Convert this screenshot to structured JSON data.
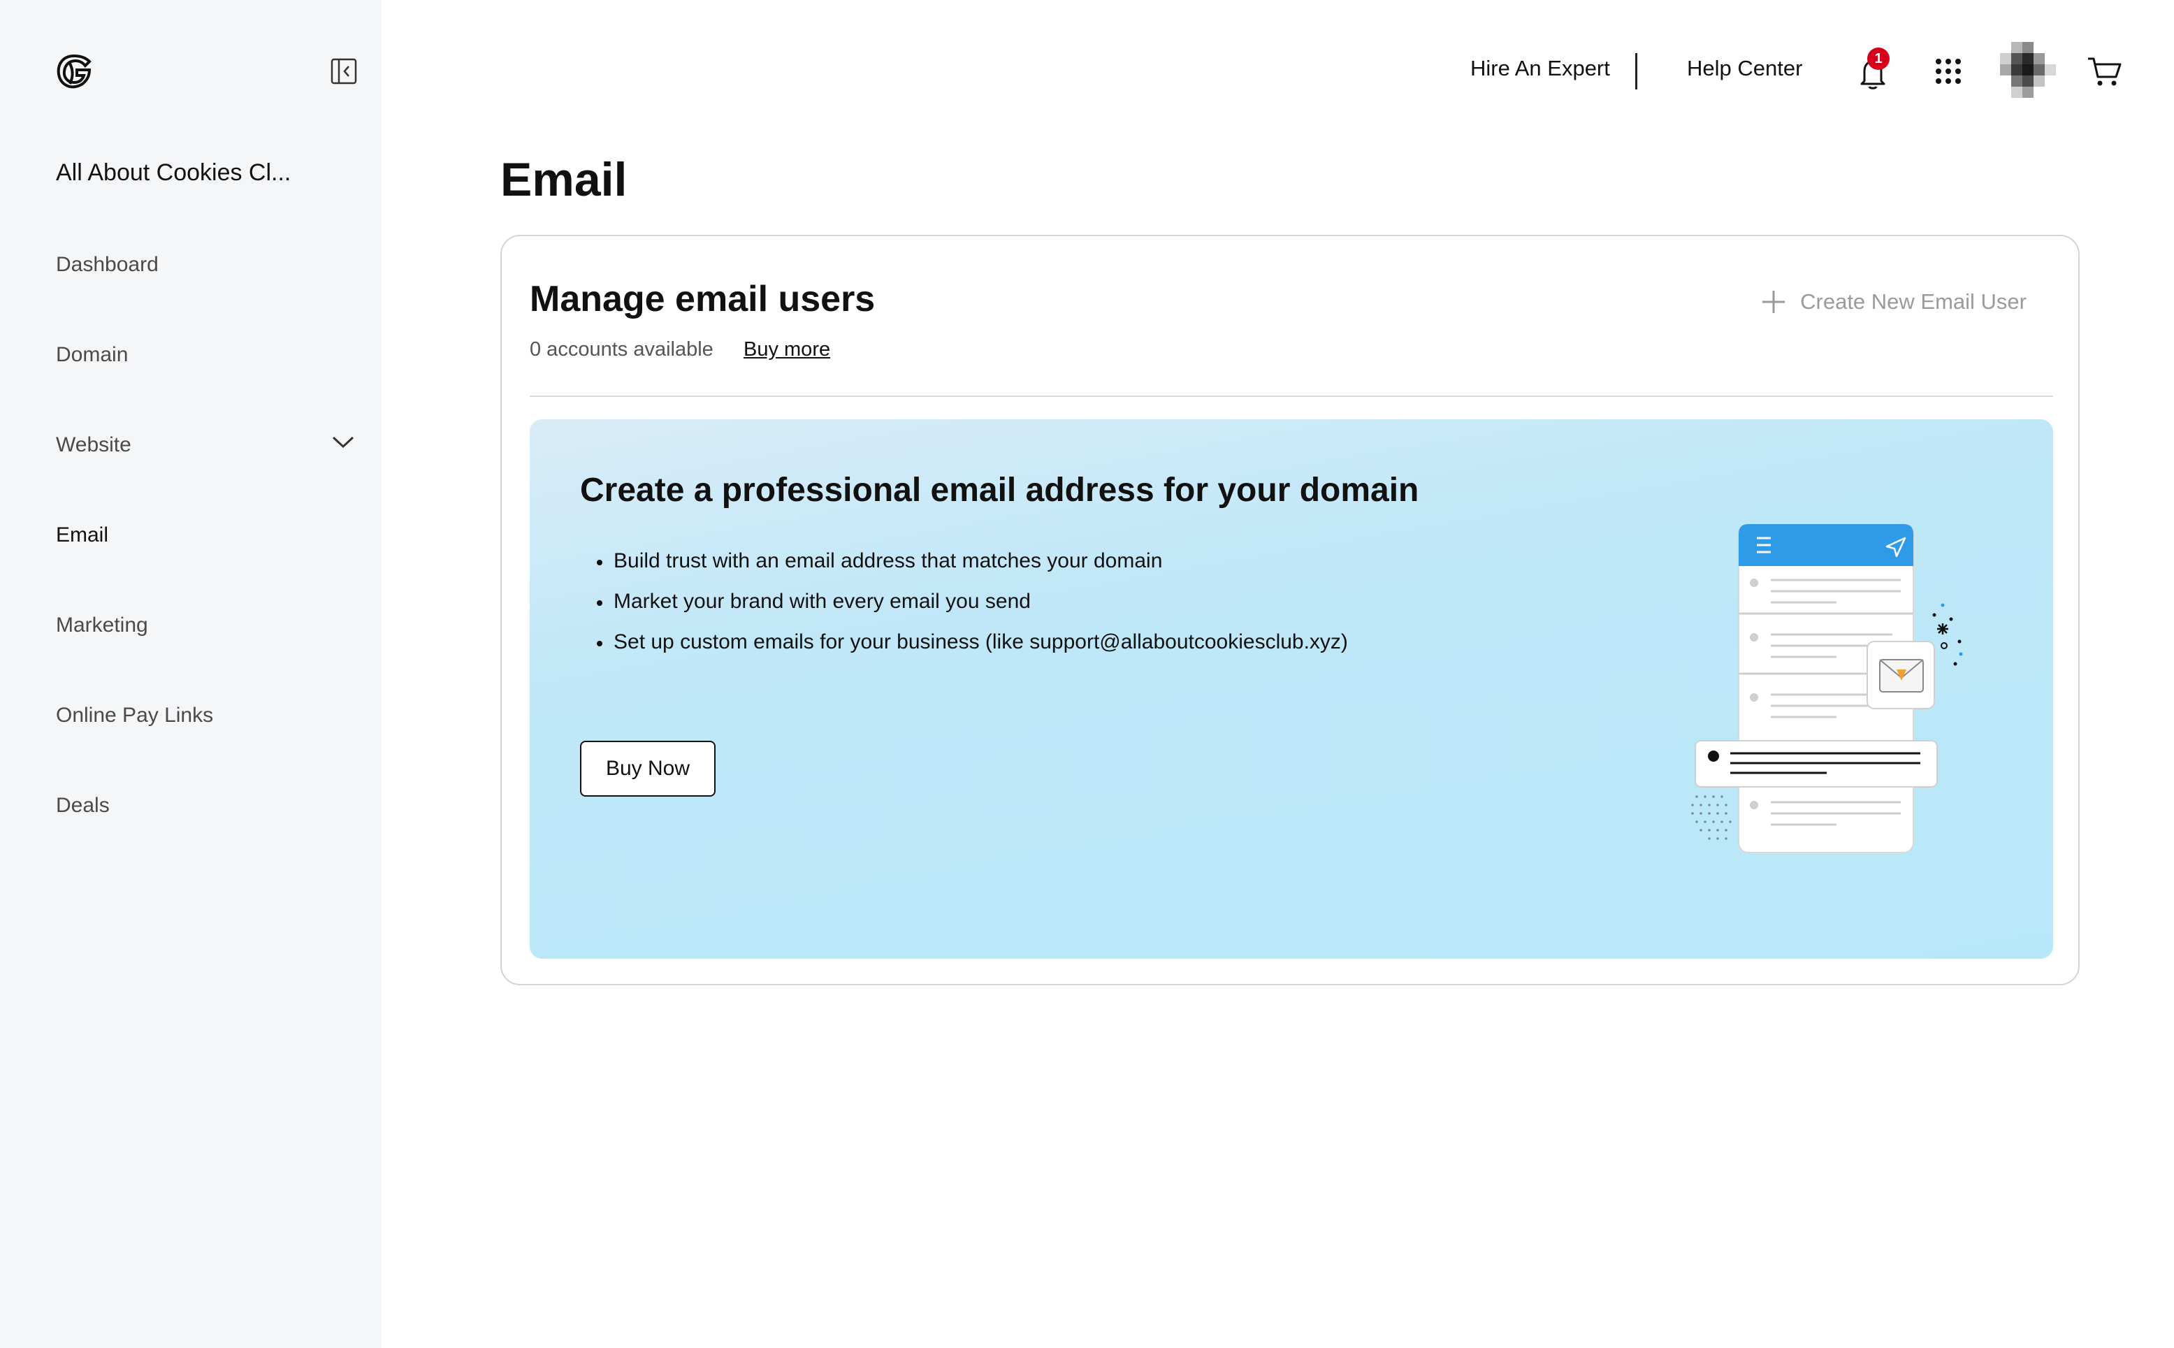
{
  "sidebar": {
    "account_name": "All About Cookies Cl...",
    "items": [
      {
        "label": "Dashboard",
        "active": false
      },
      {
        "label": "Domain",
        "active": false
      },
      {
        "label": "Website",
        "active": false,
        "expandable": true
      },
      {
        "label": "Email",
        "active": true
      },
      {
        "label": "Marketing",
        "active": false
      },
      {
        "label": "Online Pay Links",
        "active": false
      },
      {
        "label": "Deals",
        "active": false
      }
    ]
  },
  "header": {
    "hire_expert": "Hire An Expert",
    "help_center": "Help Center",
    "notification_count": "1",
    "icons": [
      "bell-icon",
      "apps-grid-icon",
      "avatar",
      "cart-icon"
    ]
  },
  "main": {
    "title": "Email",
    "card": {
      "title": "Manage email users",
      "accounts_available": "0 accounts available",
      "buy_more": "Buy more",
      "create_user": "Create New Email User",
      "promo": {
        "title": "Create a professional email address for your domain",
        "bullets": [
          "Build trust with an email address that matches your domain",
          "Market your brand with every email you send",
          "Set up custom emails for your business (like support@allaboutcookiesclub.xyz)"
        ],
        "button": "Buy Now"
      }
    }
  },
  "colors": {
    "sidebar_bg": "#f5f6f8",
    "promo_bg": "#b7e8f9",
    "badge": "#d6001c",
    "phone_header": "#2f9be8",
    "disabled_text": "#9a9a9a"
  }
}
